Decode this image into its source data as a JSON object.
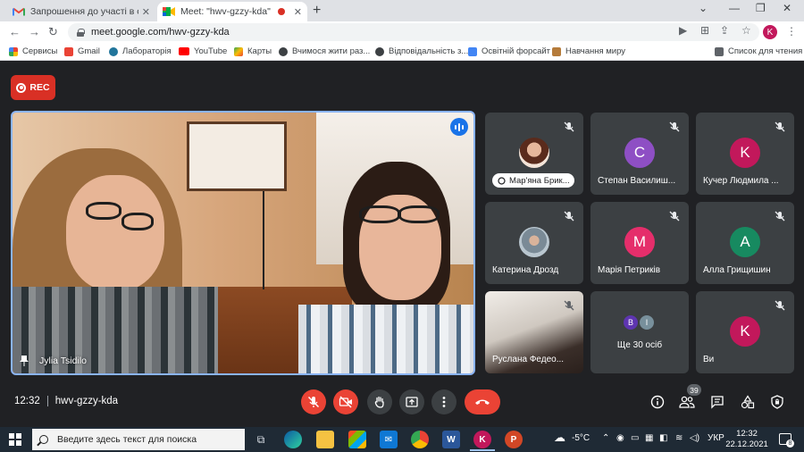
{
  "browser": {
    "tabs": [
      {
        "title": "Запрошення до участі в освітн"
      },
      {
        "title": "Meet: \"hwv-gzzy-kda\""
      }
    ],
    "url": "meet.google.com/hwv-gzzy-kda",
    "profile_initial": "K",
    "bookmarks": [
      {
        "label": "Сервисы"
      },
      {
        "label": "Gmail"
      },
      {
        "label": "Лабораторія"
      },
      {
        "label": "YouTube"
      },
      {
        "label": "Карты"
      },
      {
        "label": "Вчимося жити раз..."
      },
      {
        "label": "Відповідальність з..."
      },
      {
        "label": "Освітній форсайт"
      },
      {
        "label": "Навчання миру"
      }
    ],
    "reading_list": "Список для чтения"
  },
  "meet": {
    "rec_label": "REC",
    "main_speaker": "Jylia Tsidilo",
    "tiles": [
      {
        "name": "Мар'яна Брик...",
        "avatar": "photo"
      },
      {
        "name": "Степан Василиш...",
        "initial": "С",
        "color": "#8e4fc4"
      },
      {
        "name": "Кучер Людмила ...",
        "initial": "K",
        "color": "#c2185b"
      },
      {
        "name": "Катерина Дрозд",
        "avatar": "photo"
      },
      {
        "name": "Марія Петриків",
        "initial": "M",
        "color": "#e52e6b"
      },
      {
        "name": "Алла Грищишин",
        "initial": "A",
        "color": "#178a60"
      },
      {
        "name": "Руслана Федео...",
        "avatar": "video"
      },
      {
        "name": "Ще 30 осіб",
        "initials": [
          "B",
          "I"
        ]
      },
      {
        "name": "Ви",
        "initial": "K",
        "color": "#c2185b"
      }
    ],
    "time": "12:32",
    "meeting_code": "hwv-gzzy-kda",
    "participants_count": "39"
  },
  "taskbar": {
    "search_placeholder": "Введите здесь текст для поиска",
    "weather": "-5°C",
    "language": "УКР",
    "clock_time": "12:32",
    "clock_date": "22.12.2021",
    "notification_count": "8"
  }
}
